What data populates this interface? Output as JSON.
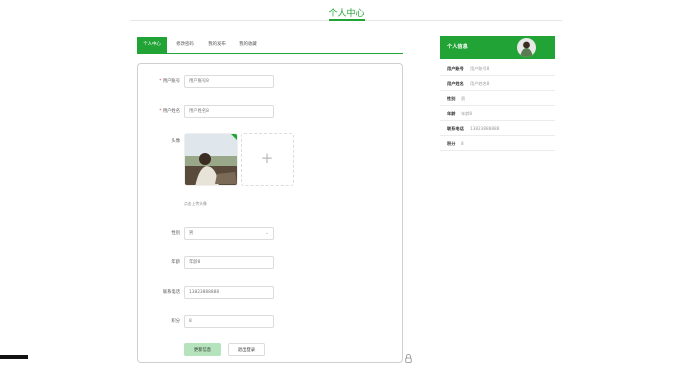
{
  "page_title": "个人中心",
  "colors": {
    "accent": "#22a335",
    "save_button_bg": "#b5e3bb"
  },
  "tabs": [
    {
      "label": "个人中心",
      "active": true
    },
    {
      "label": "修改密码",
      "active": false
    },
    {
      "label": "我的发布",
      "active": false
    },
    {
      "label": "我的收藏",
      "active": false
    }
  ],
  "form": {
    "account": {
      "label": "用户账号",
      "required": "*",
      "value": "用户账号8"
    },
    "name": {
      "label": "用户姓名",
      "required": "*",
      "value": "用户姓名8"
    },
    "avatar": {
      "label": "头像",
      "hint": "点击上传头像",
      "upload_icon": "plus-icon"
    },
    "gender": {
      "label": "性别",
      "value": "男",
      "icon": "chevron-down-icon"
    },
    "age": {
      "label": "年龄",
      "value": "年龄8"
    },
    "phone": {
      "label": "联系电话",
      "value": "13823888888"
    },
    "points": {
      "label": "积分",
      "value": "8"
    },
    "save_button": "更新信息",
    "logout_button": "退出登录"
  },
  "sidebar": {
    "title": "个人信息",
    "rows": [
      {
        "key": "用户账号",
        "value": "用户账号8"
      },
      {
        "key": "用户姓名",
        "value": "用户姓名8"
      },
      {
        "key": "性别",
        "value": "男"
      },
      {
        "key": "年龄",
        "value": "年龄8"
      },
      {
        "key": "联系电话",
        "value": "13823888888"
      },
      {
        "key": "积分",
        "value": "8"
      }
    ]
  },
  "icons": {
    "lock": "lock-icon"
  }
}
